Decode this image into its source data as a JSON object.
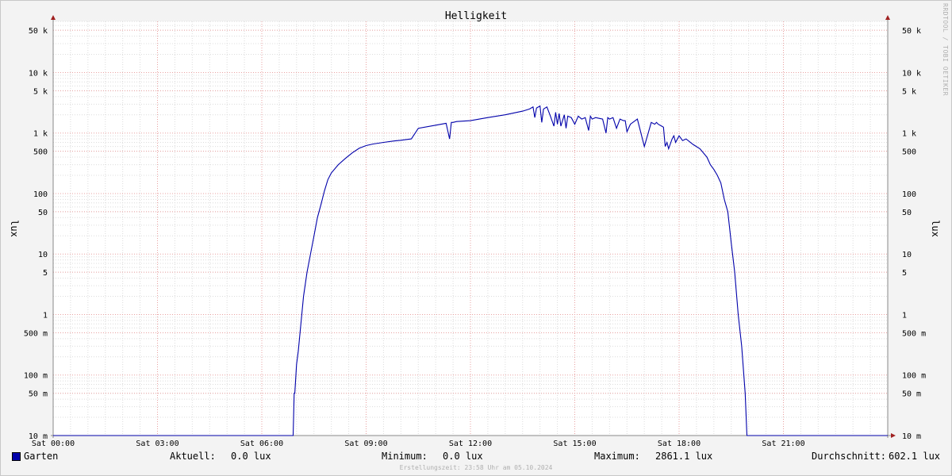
{
  "title": "Helligkeit",
  "watermark": "RRDTOOL / TOBI OETIKER",
  "footer": "Erstellungszeit: 23:58 Uhr am 05.10.2024",
  "legend": {
    "series_name": "Garten",
    "current_label": "Aktuell:",
    "current_value": "0.0 lux",
    "min_label": "Minimum:",
    "min_value": "0.0 lux",
    "max_label": "Maximum:",
    "max_value": "2861.1 lux",
    "avg_label": "Durchschnitt:",
    "avg_value": "602.1 lux"
  },
  "colors": {
    "series": "#0000aa",
    "grid_major": "#e8a0a0",
    "grid_minor": "#dcdcdc",
    "axis": "#888888",
    "arrow": "#a02020"
  },
  "chart_data": {
    "type": "line",
    "title": "Helligkeit",
    "ylabel": "lux",
    "ylabel_right": "lux",
    "yscale": "log",
    "ylim": [
      0.01,
      70000
    ],
    "xlim": [
      0,
      24
    ],
    "grid": true,
    "x_ticks": [
      {
        "x": 0,
        "label": "Sat 00:00"
      },
      {
        "x": 3,
        "label": "Sat 03:00"
      },
      {
        "x": 6,
        "label": "Sat 06:00"
      },
      {
        "x": 9,
        "label": "Sat 09:00"
      },
      {
        "x": 12,
        "label": "Sat 12:00"
      },
      {
        "x": 15,
        "label": "Sat 15:00"
      },
      {
        "x": 18,
        "label": "Sat 18:00"
      },
      {
        "x": 21,
        "label": "Sat 21:00"
      }
    ],
    "y_ticks": [
      {
        "y": 0.01,
        "label": "10 m"
      },
      {
        "y": 0.05,
        "label": "50 m"
      },
      {
        "y": 0.1,
        "label": "100 m"
      },
      {
        "y": 0.5,
        "label": "500 m"
      },
      {
        "y": 1,
        "label": "1"
      },
      {
        "y": 5,
        "label": "5"
      },
      {
        "y": 10,
        "label": "10"
      },
      {
        "y": 50,
        "label": "50"
      },
      {
        "y": 100,
        "label": "100"
      },
      {
        "y": 500,
        "label": "500"
      },
      {
        "y": 1000,
        "label": "1 k"
      },
      {
        "y": 5000,
        "label": "5 k"
      },
      {
        "y": 10000,
        "label": "10 k"
      },
      {
        "y": 50000,
        "label": "50 k"
      }
    ],
    "series": [
      {
        "name": "Garten",
        "x": [
          0,
          6.9,
          6.93,
          6.95,
          7.0,
          7.05,
          7.1,
          7.15,
          7.2,
          7.3,
          7.4,
          7.5,
          7.6,
          7.7,
          7.8,
          7.9,
          8.0,
          8.2,
          8.4,
          8.6,
          8.8,
          9.0,
          9.2,
          9.5,
          9.8,
          10.0,
          10.3,
          10.5,
          11.0,
          11.3,
          11.4,
          11.45,
          11.5,
          11.6,
          12.0,
          12.5,
          13.0,
          13.5,
          13.7,
          13.8,
          13.85,
          13.9,
          14.0,
          14.05,
          14.1,
          14.2,
          14.3,
          14.4,
          14.45,
          14.5,
          14.55,
          14.6,
          14.7,
          14.75,
          14.8,
          14.9,
          15.0,
          15.1,
          15.2,
          15.3,
          15.4,
          15.45,
          15.5,
          15.6,
          15.7,
          15.8,
          15.9,
          15.95,
          16.0,
          16.1,
          16.2,
          16.3,
          16.4,
          16.45,
          16.5,
          16.6,
          16.8,
          17.0,
          17.2,
          17.3,
          17.35,
          17.4,
          17.5,
          17.55,
          17.6,
          17.65,
          17.7,
          17.8,
          17.85,
          17.9,
          18.0,
          18.1,
          18.2,
          18.4,
          18.6,
          18.8,
          18.9,
          19.0,
          19.1,
          19.2,
          19.3,
          19.4,
          19.5,
          19.6,
          19.7,
          19.8,
          19.9,
          19.95,
          20.0,
          24
        ],
        "values": [
          0.01,
          0.01,
          0.05,
          0.05,
          0.15,
          0.25,
          0.5,
          1.0,
          2.0,
          5.0,
          10.0,
          20.0,
          40.0,
          65.0,
          110.0,
          170.0,
          220.0,
          300.0,
          380.0,
          470.0,
          560.0,
          620.0,
          660.0,
          700.0,
          740.0,
          760.0,
          800.0,
          1200.0,
          1350.0,
          1450.0,
          800.0,
          1500.0,
          1500.0,
          1550.0,
          1600.0,
          1800.0,
          2000.0,
          2300.0,
          2500.0,
          2700.0,
          1800.0,
          2600.0,
          2800.0,
          1500.0,
          2500.0,
          2700.0,
          1900.0,
          1300.0,
          2200.0,
          1400.0,
          2100.0,
          1300.0,
          2000.0,
          1200.0,
          1900.0,
          1800.0,
          1400.0,
          1900.0,
          1700.0,
          1800.0,
          1100.0,
          1900.0,
          1700.0,
          1800.0,
          1750.0,
          1700.0,
          1000.0,
          1800.0,
          1700.0,
          1800.0,
          1200.0,
          1700.0,
          1600.0,
          1600.0,
          1050.0,
          1400.0,
          1700.0,
          600.0,
          1500.0,
          1400.0,
          1500.0,
          1400.0,
          1300.0,
          1250.0,
          600.0,
          700.0,
          550.0,
          800.0,
          900.0,
          700.0,
          900.0,
          750.0,
          800.0,
          650.0,
          550.0,
          400.0,
          300.0,
          250.0,
          200.0,
          150.0,
          80.0,
          50.0,
          15.0,
          5.0,
          1.0,
          0.3,
          0.05,
          0.01,
          0.01,
          0.01
        ]
      }
    ]
  }
}
